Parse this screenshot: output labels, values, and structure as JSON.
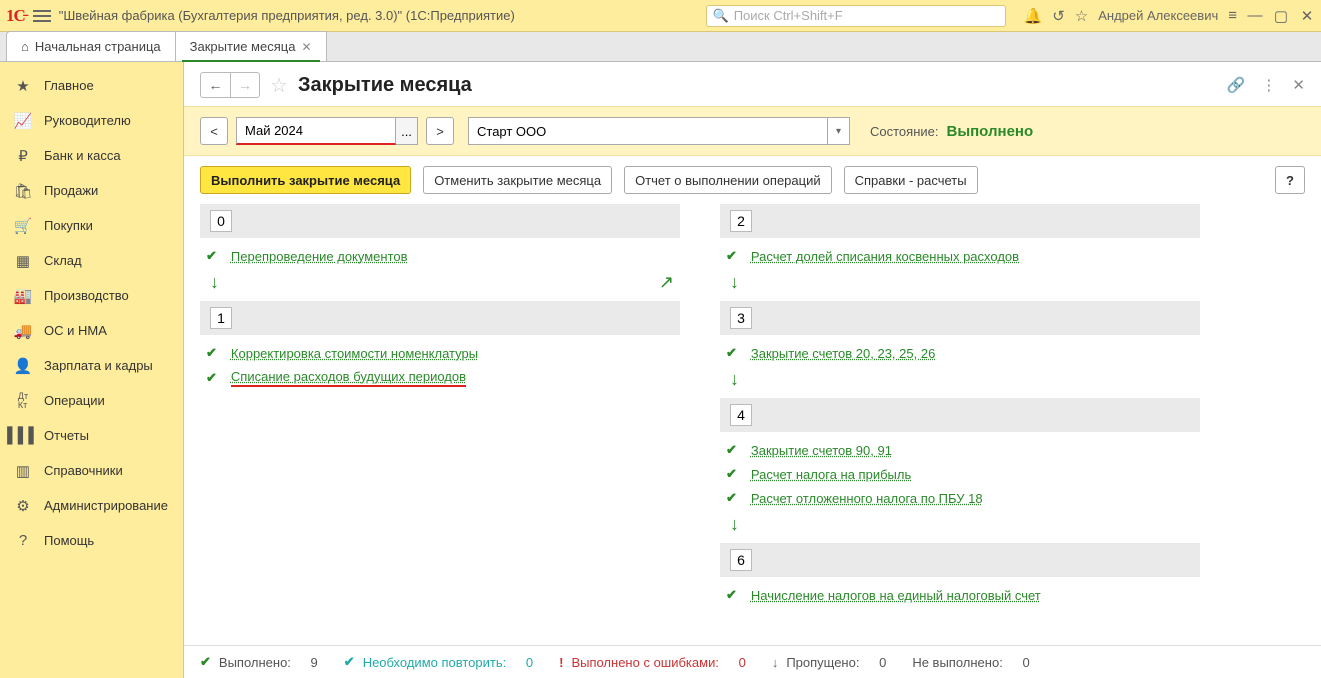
{
  "titlebar": {
    "caption": "\"Швейная фабрика (Бухгалтерия предприятия, ред. 3.0)\"  (1С:Предприятие)",
    "search_placeholder": "Поиск Ctrl+Shift+F",
    "user": "Андрей Алексеевич"
  },
  "tabs": {
    "home": "Начальная страница",
    "active": "Закрытие месяца"
  },
  "sidebar": {
    "items": [
      {
        "label": "Главное"
      },
      {
        "label": "Руководителю"
      },
      {
        "label": "Банк и касса"
      },
      {
        "label": "Продажи"
      },
      {
        "label": "Покупки"
      },
      {
        "label": "Склад"
      },
      {
        "label": "Производство"
      },
      {
        "label": "ОС и НМА"
      },
      {
        "label": "Зарплата и кадры"
      },
      {
        "label": "Операции"
      },
      {
        "label": "Отчеты"
      },
      {
        "label": "Справочники"
      },
      {
        "label": "Администрирование"
      },
      {
        "label": "Помощь"
      }
    ]
  },
  "page": {
    "title": "Закрытие месяца",
    "period": "Май 2024",
    "org": "Старт ООО",
    "status_label": "Состояние:",
    "status_value": "Выполнено",
    "prev": "<",
    "next": ">",
    "dots": "..."
  },
  "actions": {
    "run": "Выполнить закрытие месяца",
    "cancel": "Отменить закрытие месяца",
    "report": "Отчет о выполнении операций",
    "refs": "Справки - расчеты",
    "help": "?"
  },
  "stages": {
    "left": [
      {
        "num": "0",
        "ops": [
          {
            "label": "Перепроведение документов",
            "red": false
          }
        ]
      },
      {
        "num": "1",
        "ops": [
          {
            "label": "Корректировка стоимости номенклатуры",
            "red": false
          },
          {
            "label": "Списание расходов будущих периодов",
            "red": true
          }
        ]
      }
    ],
    "right": [
      {
        "num": "2",
        "ops": [
          {
            "label": "Расчет долей списания косвенных расходов",
            "red": false
          }
        ]
      },
      {
        "num": "3",
        "ops": [
          {
            "label": "Закрытие счетов 20, 23, 25, 26",
            "red": false
          }
        ]
      },
      {
        "num": "4",
        "ops": [
          {
            "label": "Закрытие счетов 90, 91",
            "red": false
          },
          {
            "label": "Расчет налога на прибыль",
            "red": false
          },
          {
            "label": "Расчет отложенного налога по ПБУ 18",
            "red": false
          }
        ]
      },
      {
        "num": "6",
        "ops": [
          {
            "label": "Начисление налогов на единый налоговый счет",
            "red": false
          }
        ]
      }
    ]
  },
  "statusbar": {
    "done_label": "Выполнено:",
    "done": "9",
    "repeat_label": "Необходимо повторить:",
    "repeat": "0",
    "errors_label": "Выполнено с ошибками:",
    "errors": "0",
    "skipped_label": "Пропущено:",
    "skipped": "0",
    "notdone_label": "Не выполнено:",
    "notdone": "0"
  }
}
